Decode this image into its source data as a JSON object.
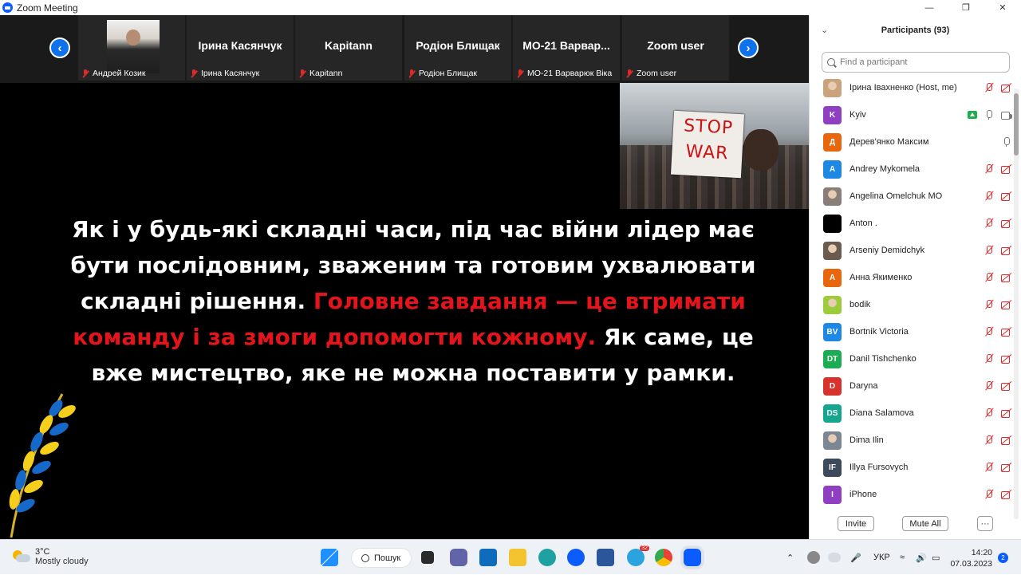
{
  "window": {
    "title": "Zoom Meeting"
  },
  "video_strip": {
    "tiles": [
      {
        "big_name": "",
        "caption": "Андрей Козик",
        "has_photo": true
      },
      {
        "big_name": "Ірина Касянчук",
        "caption": "Ірина Касянчук"
      },
      {
        "big_name": "Kapitann",
        "caption": "Kapitann"
      },
      {
        "big_name": "Родіон Блищак",
        "caption": "Родіон Блищак"
      },
      {
        "big_name": "МО-21 Варвар...",
        "caption": "МО-21 Варварюк Віка"
      },
      {
        "big_name": "Zoom user",
        "caption": "Zoom user"
      }
    ]
  },
  "slide": {
    "sign_line1": "STOP",
    "sign_line2": "WAR",
    "text_white_1": "Як і у будь-які складні часи, під час війни лідер має бути послідовним, зваженим та готовим ухвалювати складні рішення.",
    "text_red": "Головне завдання — це втримати команду і за змоги допомогти кожному.",
    "text_white_2": "Як саме, це вже мистецтво, яке не можна поставити у рамки."
  },
  "participants": {
    "title": "Participants (93)",
    "search_placeholder": "Find a participant",
    "list": [
      {
        "name": "Ірина Івахненко (Host, me)",
        "avatar": "",
        "color": "#c9a27e",
        "photo": true,
        "icons": [
          "mic-off",
          "vid-off"
        ]
      },
      {
        "name": "Kyiv",
        "avatar": "K",
        "color": "#8e3fc2",
        "icons": [
          "share-on",
          "mic-on",
          "vid-on"
        ]
      },
      {
        "name": "Дерев'янко Максим",
        "avatar": "Д",
        "color": "#e8660e",
        "icons": [
          "mic-on"
        ]
      },
      {
        "name": "Andrey Mykomela",
        "avatar": "A",
        "color": "#1e88e5",
        "icons": [
          "mic-off",
          "vid-off"
        ]
      },
      {
        "name": "Angelina Omelchuk МО",
        "avatar": "",
        "color": "#8a7f78",
        "photo": true,
        "icons": [
          "mic-off",
          "vid-off"
        ]
      },
      {
        "name": "Anton .",
        "avatar": "",
        "color": "#000000",
        "icons": [
          "mic-off",
          "vid-off"
        ]
      },
      {
        "name": "Arseniy Demidchyk",
        "avatar": "",
        "color": "#6b5b4e",
        "photo": true,
        "icons": [
          "mic-off",
          "vid-off"
        ]
      },
      {
        "name": "Анна Якименко",
        "avatar": "А",
        "color": "#e8660e",
        "icons": [
          "mic-off",
          "vid-off"
        ]
      },
      {
        "name": "bodik",
        "avatar": "",
        "color": "#9ccc3c",
        "photo": true,
        "icons": [
          "mic-off",
          "vid-off"
        ]
      },
      {
        "name": "Bortnik Victoria",
        "avatar": "BV",
        "color": "#1e88e5",
        "icons": [
          "mic-off",
          "vid-off"
        ]
      },
      {
        "name": "Danil Tishchenko",
        "avatar": "DT",
        "color": "#1cad54",
        "icons": [
          "mic-off",
          "vid-off"
        ]
      },
      {
        "name": "Daryna",
        "avatar": "D",
        "color": "#d8322c",
        "icons": [
          "mic-off",
          "vid-off"
        ]
      },
      {
        "name": "Diana Salamova",
        "avatar": "DS",
        "color": "#16a58e",
        "icons": [
          "mic-off",
          "vid-off"
        ]
      },
      {
        "name": "Dima Ilin",
        "avatar": "",
        "color": "#7d8794",
        "photo": true,
        "icons": [
          "mic-off",
          "vid-off"
        ]
      },
      {
        "name": "Illya Fursovych",
        "avatar": "IF",
        "color": "#3e4a5c",
        "icons": [
          "mic-off",
          "vid-off"
        ]
      },
      {
        "name": "iPhone",
        "avatar": "I",
        "color": "#8e3fc2",
        "icons": [
          "mic-off",
          "vid-off"
        ]
      }
    ],
    "invite_label": "Invite",
    "mute_all_label": "Mute All",
    "more_label": "···"
  },
  "taskbar": {
    "temperature": "3°C",
    "weather": "Mostly cloudy",
    "search_label": "Пошук",
    "telegram_badge": "32",
    "language": "УКР",
    "time": "14:20",
    "date": "07.03.2023",
    "notification_count": "2"
  }
}
